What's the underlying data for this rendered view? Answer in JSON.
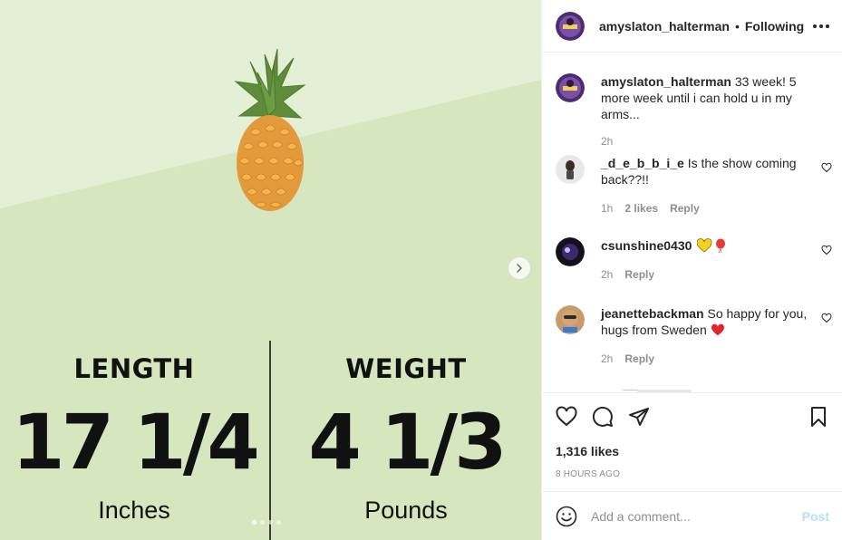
{
  "post": {
    "username": "amyslaton_halterman",
    "separator": "•",
    "follow_label": "Following",
    "more_icon": "more-horizontal-icon"
  },
  "media": {
    "image": "pineapple-illustration",
    "length_label": "LENGTH",
    "length_value": "17 1/4",
    "length_unit": "Inches",
    "weight_label": "WEIGHT",
    "weight_value": "4 1/3",
    "weight_unit": "Pounds",
    "carousel_count": 4,
    "carousel_active": 1,
    "next_icon": "chevron-right-icon",
    "colors": {
      "bg_dark": "#d6e7c0",
      "bg_light": "#e4f0d6"
    }
  },
  "caption": {
    "username": "amyslaton_halterman",
    "text": "33 week! 5 more week until i can hold u in my arms...",
    "time": "2h"
  },
  "comments": [
    {
      "username": "_d_e_b_b_i_e",
      "text": "Is the show coming back??!!",
      "time": "1h",
      "likes": "2 likes",
      "reply": "Reply"
    },
    {
      "username": "csunshine0430",
      "text": "",
      "emoji": [
        "yellow-heart",
        "balloon"
      ],
      "time": "2h",
      "likes": "",
      "reply": "Reply"
    },
    {
      "username": "jeanettebackman",
      "text": "So happy for you, hugs from Sweden",
      "emoji": [
        "red-heart"
      ],
      "time": "2h",
      "likes": "",
      "reply": "Reply"
    }
  ],
  "actions": {
    "likes": "1,316 likes",
    "time_ago": "8 HOURS AGO"
  },
  "add_comment": {
    "placeholder": "Add a comment...",
    "post_label": "Post"
  }
}
